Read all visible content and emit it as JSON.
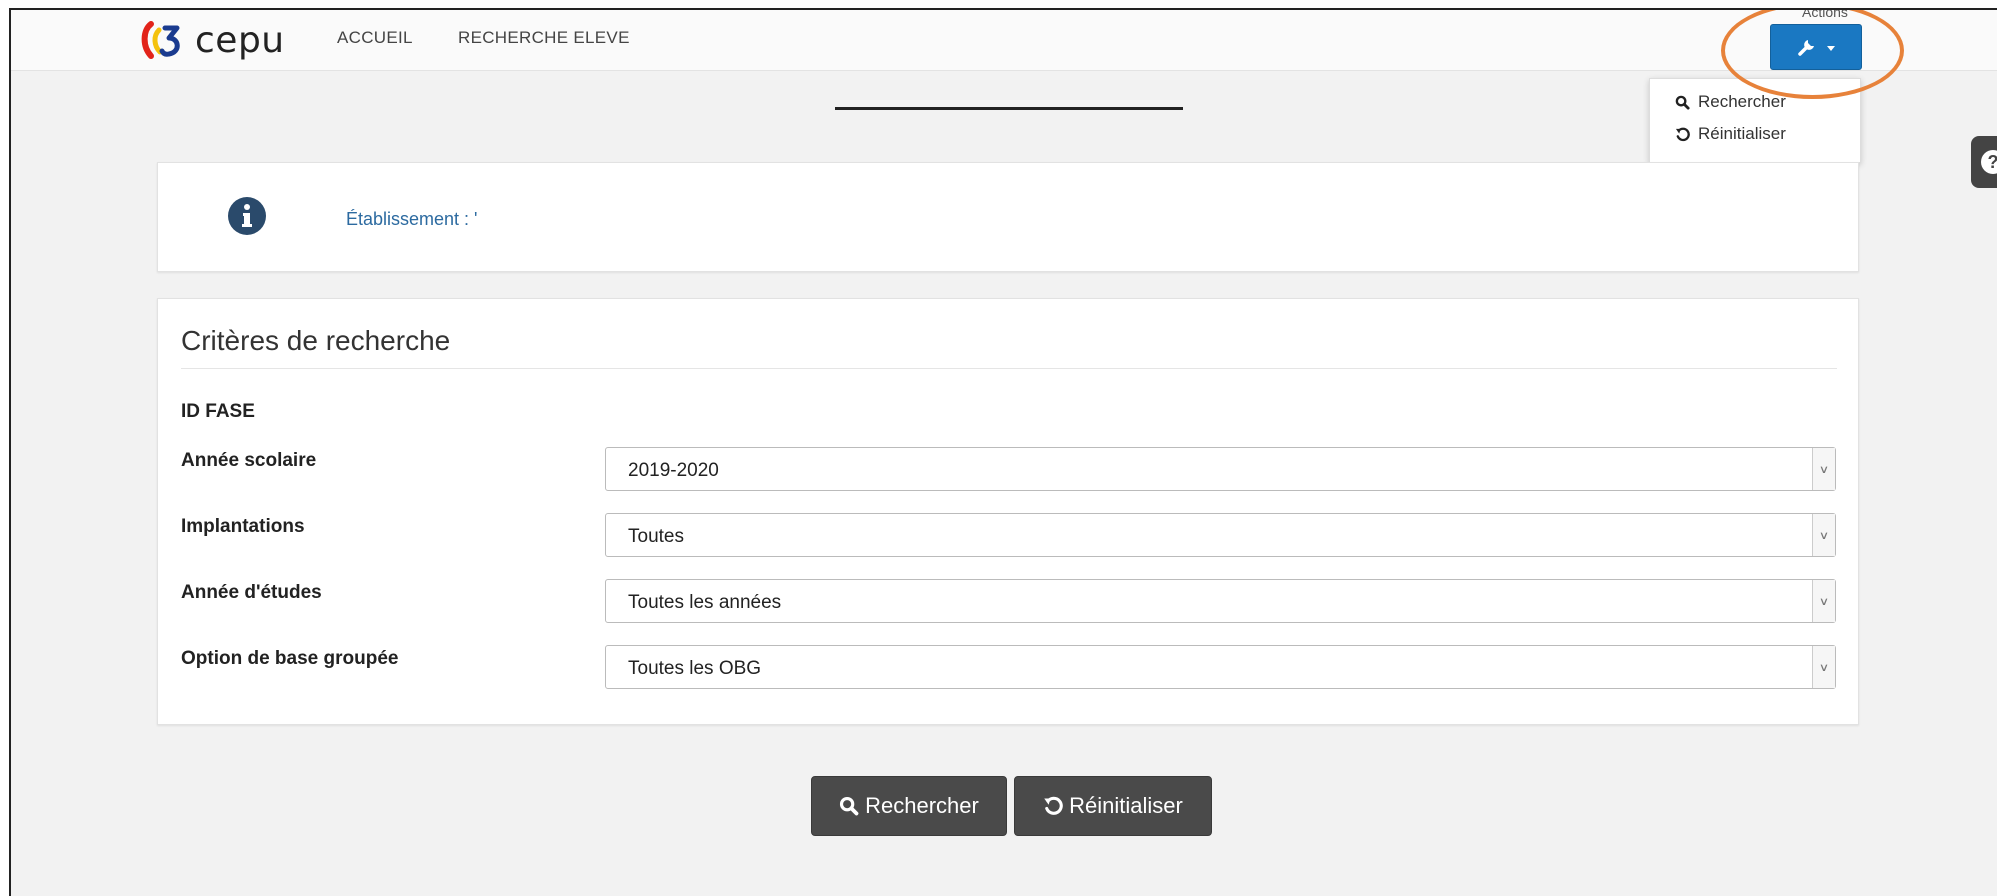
{
  "header": {
    "logo_text": "cepu",
    "nav": [
      "ACCUEIL",
      "RECHERCHE ELEVE"
    ],
    "actions_label": "Actions"
  },
  "dropdown": {
    "items": [
      "Rechercher",
      "Réinitialiser"
    ]
  },
  "info": {
    "etablissement_label": "Établissement : '"
  },
  "criteria": {
    "title": "Critères de recherche",
    "id_label": "ID FASE",
    "fields": [
      {
        "label": "Année scolaire",
        "value": "2019-2020"
      },
      {
        "label": "Implantations",
        "value": "Toutes"
      },
      {
        "label": "Année d'études",
        "value": "Toutes les années"
      },
      {
        "label": "Option de base groupée",
        "value": "Toutes les OBG"
      }
    ]
  },
  "buttons": {
    "search": "Rechercher",
    "reset": "Réinitialiser"
  },
  "colors": {
    "accent": "#1a78c2",
    "highlight": "#e7823a",
    "button_dark": "#4a4a4a"
  }
}
